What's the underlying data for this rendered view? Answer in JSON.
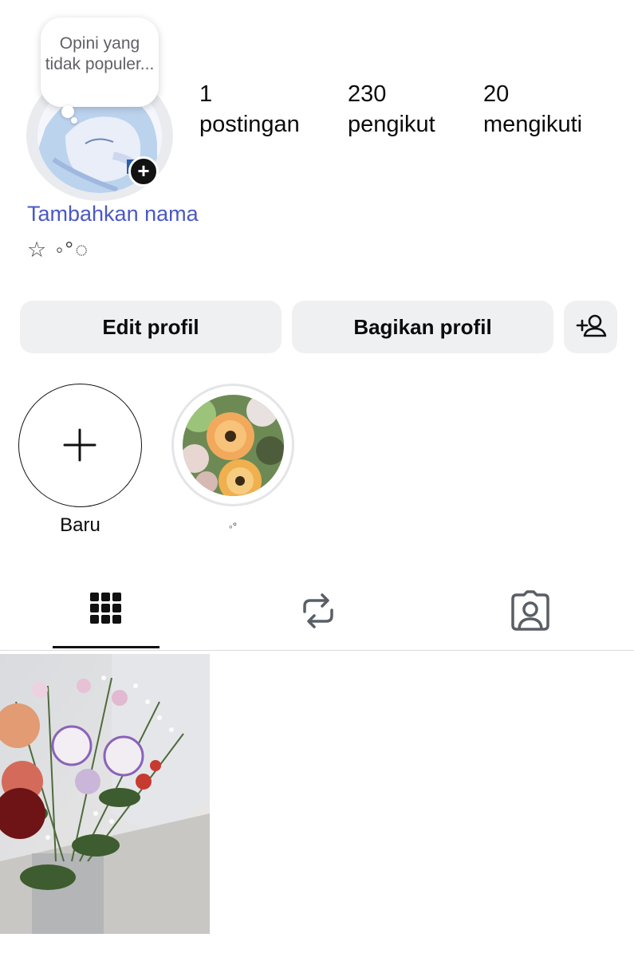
{
  "profile": {
    "note": "Opini yang tidak populer...",
    "stats": [
      {
        "value": "1",
        "label": "postingan"
      },
      {
        "value": "230",
        "label": "pengikut"
      },
      {
        "value": "20",
        "label": "mengikuti"
      }
    ],
    "add_name_link": "Tambahkan nama",
    "bio": "☆ ◦°◌",
    "colors": {
      "link": "#4a59c4",
      "button_bg": "#eff0f2"
    }
  },
  "actions": {
    "edit_profile": "Edit profil",
    "share_profile": "Bagikan profil",
    "discover_icon": "add-person-icon"
  },
  "highlights": [
    {
      "label": "Baru",
      "icon": "plus-icon"
    },
    {
      "label": "◦°",
      "image": "flowers"
    }
  ],
  "tabs": [
    {
      "name": "posts",
      "icon": "grid-icon",
      "selected": true
    },
    {
      "name": "reposts",
      "icon": "repost-icon",
      "selected": false
    },
    {
      "name": "tagged",
      "icon": "tagged-person-icon",
      "selected": false
    }
  ],
  "posts": [
    {
      "image": "flower bouquet in vase"
    }
  ]
}
